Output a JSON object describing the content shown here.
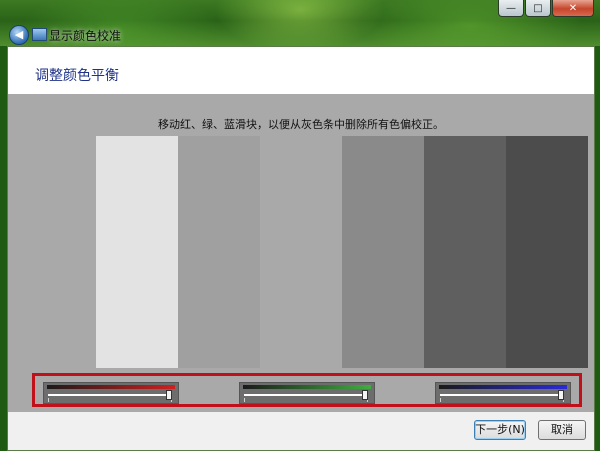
{
  "window": {
    "title": "显示颜色校准",
    "controls": {
      "minimize": "—",
      "maximize": "□",
      "close": "✕"
    },
    "back_glyph": "◀"
  },
  "header": {
    "title": "调整颜色平衡"
  },
  "instruction": "移动红、绿、蓝滑块，以便从灰色条中删除所有色偏校正。",
  "gray_bars": [
    "#e3e3e3",
    "#a0a0a0",
    "#a9a9a9",
    "#8a8a8a",
    "#5f5f5f",
    "#4c4c4c"
  ],
  "sliders": [
    {
      "channel": "红",
      "color": "#d02020",
      "value": 1.0
    },
    {
      "channel": "绿",
      "color": "#3fae3f",
      "value": 1.0
    },
    {
      "channel": "蓝",
      "color": "#2a2ad8",
      "value": 1.0
    }
  ],
  "buttons": {
    "next": "下一步(N)",
    "cancel": "取消"
  },
  "highlight_color": "#c0101a"
}
